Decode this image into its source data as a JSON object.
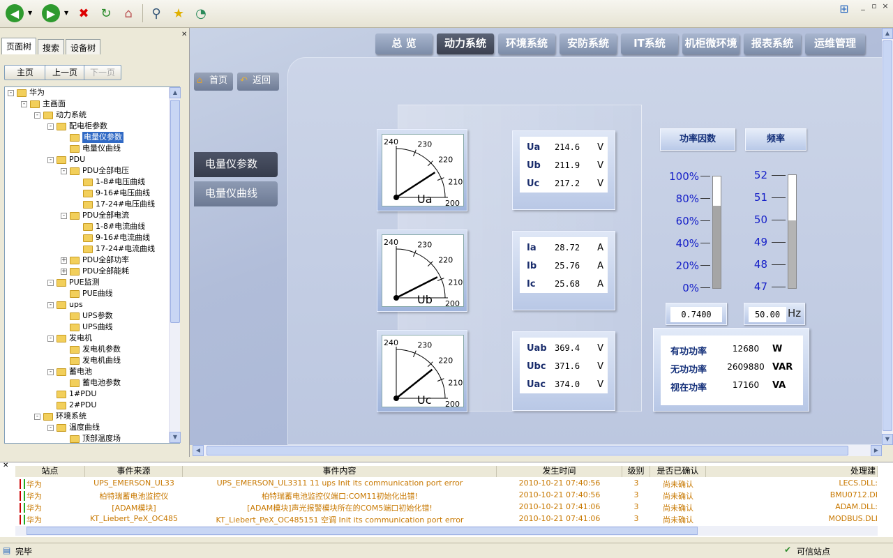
{
  "toolbar": {
    "icons": [
      "back-icon",
      "forward-icon",
      "stop-icon",
      "refresh-icon",
      "home-icon",
      "search-icon",
      "favorites-icon",
      "history-icon"
    ],
    "window_controls": [
      "_",
      "▫",
      "×"
    ]
  },
  "left_panel": {
    "tabs": [
      "页面树",
      "搜索",
      "设备树"
    ],
    "nav": {
      "home": "主页",
      "prev": "上一页",
      "next": "下一页"
    },
    "tree": [
      {
        "label": "华为",
        "depth": 0,
        "exp": "-"
      },
      {
        "label": "主画面",
        "depth": 1,
        "exp": "-"
      },
      {
        "label": "动力系统",
        "depth": 2,
        "exp": "-"
      },
      {
        "label": "配电柜参数",
        "depth": 3,
        "exp": "-"
      },
      {
        "label": "电量仪参数",
        "depth": 4,
        "exp": "",
        "selected": true
      },
      {
        "label": "电量仪曲线",
        "depth": 4,
        "exp": ""
      },
      {
        "label": "PDU",
        "depth": 3,
        "exp": "-"
      },
      {
        "label": "PDU全部电压",
        "depth": 4,
        "exp": "-"
      },
      {
        "label": "1-8#电压曲线",
        "depth": 5,
        "exp": ""
      },
      {
        "label": "9-16#电压曲线",
        "depth": 5,
        "exp": ""
      },
      {
        "label": "17-24#电压曲线",
        "depth": 5,
        "exp": ""
      },
      {
        "label": "PDU全部电流",
        "depth": 4,
        "exp": "-"
      },
      {
        "label": "1-8#电流曲线",
        "depth": 5,
        "exp": ""
      },
      {
        "label": "9-16#电流曲线",
        "depth": 5,
        "exp": ""
      },
      {
        "label": "17-24#电流曲线",
        "depth": 5,
        "exp": ""
      },
      {
        "label": "PDU全部功率",
        "depth": 4,
        "exp": "+"
      },
      {
        "label": "PDU全部能耗",
        "depth": 4,
        "exp": "+"
      },
      {
        "label": "PUE监测",
        "depth": 3,
        "exp": "-"
      },
      {
        "label": "PUE曲线",
        "depth": 4,
        "exp": ""
      },
      {
        "label": "ups",
        "depth": 3,
        "exp": "-"
      },
      {
        "label": "UPS参数",
        "depth": 4,
        "exp": ""
      },
      {
        "label": "UPS曲线",
        "depth": 4,
        "exp": ""
      },
      {
        "label": "发电机",
        "depth": 3,
        "exp": "-"
      },
      {
        "label": "发电机参数",
        "depth": 4,
        "exp": ""
      },
      {
        "label": "发电机曲线",
        "depth": 4,
        "exp": ""
      },
      {
        "label": "蓄电池",
        "depth": 3,
        "exp": "-"
      },
      {
        "label": "蓄电池参数",
        "depth": 4,
        "exp": ""
      },
      {
        "label": "1#PDU",
        "depth": 3,
        "exp": ""
      },
      {
        "label": "2#PDU",
        "depth": 3,
        "exp": ""
      },
      {
        "label": "环境系统",
        "depth": 2,
        "exp": "-"
      },
      {
        "label": "温度曲线",
        "depth": 3,
        "exp": "-"
      },
      {
        "label": "顶部温度场",
        "depth": 4,
        "exp": ""
      }
    ]
  },
  "top_nav": [
    "总 览",
    "动力系统",
    "环境系统",
    "安防系统",
    "IT系统",
    "机柜微环境",
    "报表系统",
    "运维管理"
  ],
  "sub_nav": {
    "home": "首页",
    "back": "返回"
  },
  "side_menu": [
    "电量仪参数",
    "电量仪曲线"
  ],
  "meters": [
    {
      "name": "Ua",
      "needle": 214.6,
      "scale": [
        "240",
        "230",
        "220",
        "210",
        "200"
      ]
    },
    {
      "name": "Ub",
      "needle": 211.9,
      "scale": [
        "240",
        "230",
        "220",
        "210",
        "200"
      ]
    },
    {
      "name": "Uc",
      "needle": 217.2,
      "scale": [
        "240",
        "230",
        "220",
        "210",
        "200"
      ]
    }
  ],
  "voltage_phase": [
    {
      "label": "Ua",
      "value": "214.6",
      "unit": "V"
    },
    {
      "label": "Ub",
      "value": "211.9",
      "unit": "V"
    },
    {
      "label": "Uc",
      "value": "217.2",
      "unit": "V"
    }
  ],
  "current": [
    {
      "label": "Ia",
      "value": "28.72",
      "unit": "A"
    },
    {
      "label": "Ib",
      "value": "25.76",
      "unit": "A"
    },
    {
      "label": "Ic",
      "value": "25.68",
      "unit": "A"
    }
  ],
  "voltage_line": [
    {
      "label": "Uab",
      "value": "369.4",
      "unit": "V"
    },
    {
      "label": "Ubc",
      "value": "371.6",
      "unit": "V"
    },
    {
      "label": "Uac",
      "value": "374.0",
      "unit": "V"
    }
  ],
  "power_factor": {
    "title": "功率因数",
    "scale": [
      "100%",
      "80%",
      "60%",
      "40%",
      "20%",
      "0%"
    ],
    "fill_fraction": 0.74,
    "value": "0.7400"
  },
  "frequency": {
    "title": "频率",
    "scale": [
      "52",
      "51",
      "50",
      "49",
      "48",
      "47"
    ],
    "fill_fraction": 0.6,
    "value": "50.00",
    "unit": "Hz"
  },
  "power": [
    {
      "label": "有功功率",
      "value": "12680",
      "unit": "W"
    },
    {
      "label": "无功功率",
      "value": "2609880",
      "unit": "VAR"
    },
    {
      "label": "视在功率",
      "value": "17160",
      "unit": "VA"
    }
  ],
  "events": {
    "headers": [
      "站点",
      "事件来源",
      "事件内容",
      "发生时间",
      "级别",
      "是否已确认",
      "处理建"
    ],
    "rows": [
      {
        "site": "华为",
        "source": "UPS_EMERSON_UL33",
        "content": "UPS_EMERSON_UL3311 11 ups Init its communication port error",
        "time": "2010-10-21 07:40:56",
        "level": "3",
        "confirmed": "尚未确认",
        "handler": "LECS.DLL:"
      },
      {
        "site": "华为",
        "source": "柏特瑞蓄电池监控仪",
        "content": "柏特瑞蓄电池监控仪端口:COM11初始化出错!",
        "time": "2010-10-21 07:40:56",
        "level": "3",
        "confirmed": "尚未确认",
        "handler": "BMU0712.DI"
      },
      {
        "site": "华为",
        "source": "[ADAM模块]",
        "content": "[ADAM模块]声光报警模块所在的COM5端口初始化错!",
        "time": "2010-10-21 07:41:06",
        "level": "3",
        "confirmed": "尚未确认",
        "handler": "ADAM.DLL:"
      },
      {
        "site": "华为",
        "source": "KT_Liebert_PeX_OC485",
        "content": "KT_Liebert_PeX_OC485151 空调 Init its communication port error",
        "time": "2010-10-21 07:41:06",
        "level": "3",
        "confirmed": "尚未确认",
        "handler": "MODBUS.DLI"
      }
    ]
  },
  "status": {
    "left": "完毕",
    "right": "可信站点"
  }
}
